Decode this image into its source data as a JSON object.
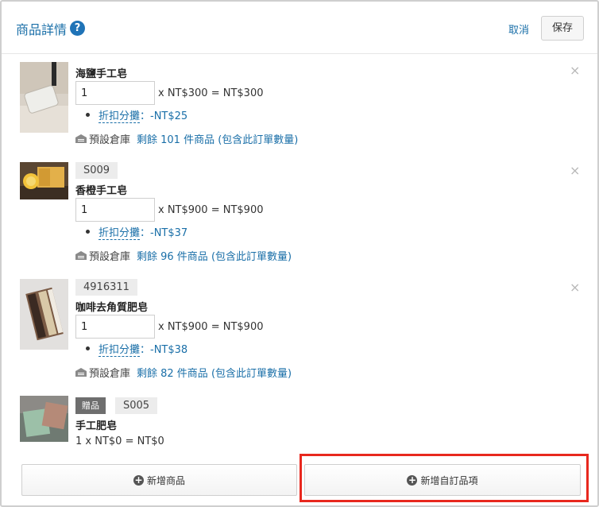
{
  "header": {
    "title": "商品詳情",
    "help_icon": "question-icon",
    "cancel_label": "取消",
    "save_label": "保存"
  },
  "items": [
    {
      "sku": "",
      "name": "海鹽手工皂",
      "quantity": "1",
      "price_line": "x NT$300 = NT$300",
      "discount_label": "折扣分攤",
      "discount_value": "：-NT$25",
      "warehouse_label": "預設倉庫",
      "stock_text": "剩餘 101 件商品 (包含此訂單數量)"
    },
    {
      "sku": "S009",
      "name": "香橙手工皂",
      "quantity": "1",
      "price_line": "x NT$900 = NT$900",
      "discount_label": "折扣分攤",
      "discount_value": "：-NT$37",
      "warehouse_label": "預設倉庫",
      "stock_text": "剩餘 96 件商品 (包含此訂單數量)"
    },
    {
      "sku": "4916311",
      "name": "咖啡去角質肥皂",
      "quantity": "1",
      "price_line": "x NT$900 = NT$900",
      "discount_label": "折扣分攤",
      "discount_value": "：-NT$38",
      "warehouse_label": "預設倉庫",
      "stock_text": "剩餘 82 件商品 (包含此訂單數量)"
    },
    {
      "gift_badge": "贈品",
      "sku": "S005",
      "name": "手工肥皂",
      "price_line": "1 x NT$0 = NT$0"
    }
  ],
  "close_icon": "×",
  "footer": {
    "add_product_label": "新增商品",
    "add_custom_item_label": "新增自訂品項"
  },
  "colors": {
    "accent": "#1a6fa8",
    "highlight": "#e8281e"
  }
}
